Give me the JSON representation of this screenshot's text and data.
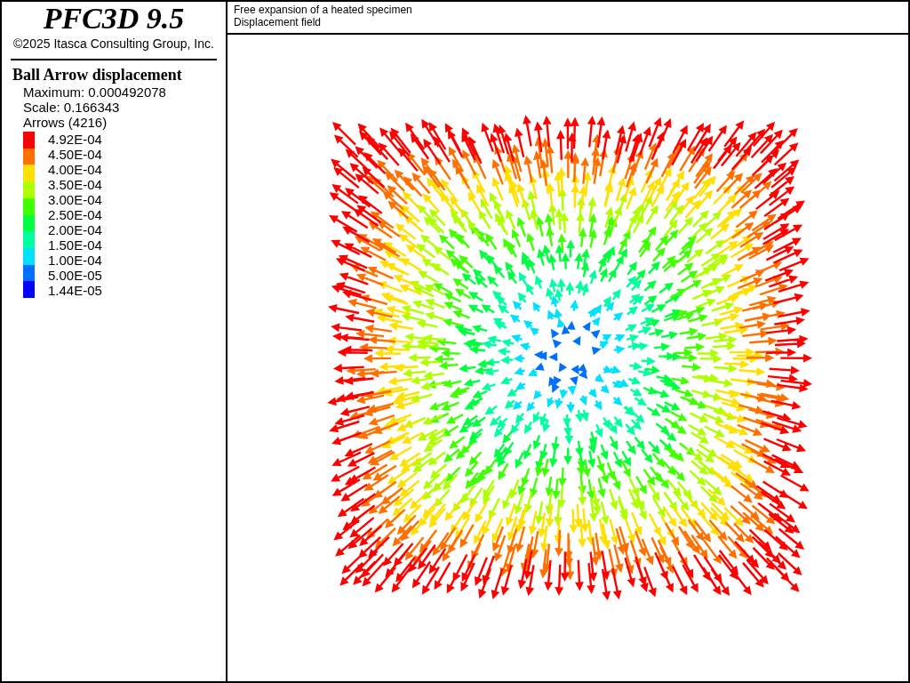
{
  "header": {
    "title": "PFC3D 9.5",
    "copyright": "©2025 Itasca Consulting Group, Inc."
  },
  "legend": {
    "title": "Ball Arrow displacement",
    "maximum": "Maximum: 0.000492078",
    "scale": "Scale: 0.166343",
    "count": "Arrows (4216)",
    "labels": [
      "4.92E-04",
      "4.50E-04",
      "4.00E-04",
      "3.50E-04",
      "3.00E-04",
      "2.50E-04",
      "2.00E-04",
      "1.50E-04",
      "1.00E-04",
      "5.00E-05",
      "1.44E-05"
    ],
    "bands": [
      {
        "color": "#ff0000"
      },
      {
        "color": "#ff7000"
      },
      {
        "color": "#ffe000"
      },
      {
        "color": "#b0ff00"
      },
      {
        "color": "#40ff00"
      },
      {
        "color": "#00ff40"
      },
      {
        "color": "#00ffa0"
      },
      {
        "color": "#00e0ff"
      },
      {
        "color": "#0070ff"
      },
      {
        "color": "#0000ff"
      }
    ]
  },
  "plot": {
    "title_lines": [
      "Free expansion of a heated specimen",
      "Displacement field"
    ]
  }
}
